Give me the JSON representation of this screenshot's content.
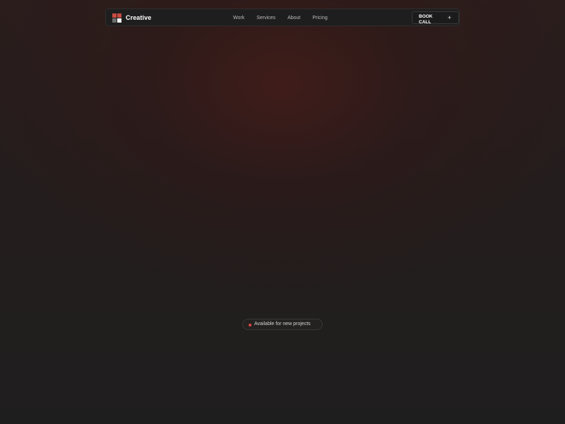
{
  "brand": {
    "name": "Creative"
  },
  "nav": {
    "links": [
      {
        "label": "Work"
      },
      {
        "label": "Services"
      },
      {
        "label": "About"
      },
      {
        "label": "Pricing"
      }
    ],
    "cta": {
      "label": "BOOK CALL",
      "icon": "plus-icon"
    }
  },
  "hero": {
    "badge": {
      "label": "Available for new projects",
      "status_color": "#d8473f"
    }
  },
  "colors": {
    "accent": "#c84a40",
    "background": "#1f1e1e"
  }
}
